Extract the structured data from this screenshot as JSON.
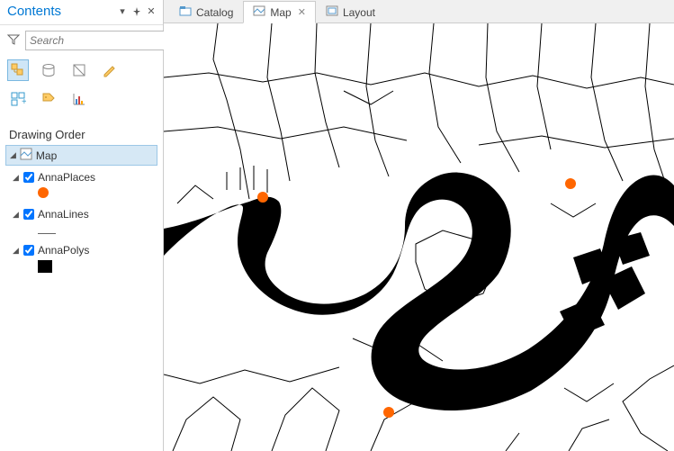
{
  "sidebar": {
    "title": "Contents",
    "search_placeholder": "Search",
    "section_title": "Drawing Order",
    "map_root_label": "Map",
    "layers": [
      {
        "name": "AnnaPlaces",
        "symbol": "point",
        "checked": true
      },
      {
        "name": "AnnaLines",
        "symbol": "line",
        "checked": true
      },
      {
        "name": "AnnaPolys",
        "symbol": "poly",
        "checked": true
      }
    ]
  },
  "tabs": {
    "catalog": "Catalog",
    "map": "Map",
    "layout": "Layout",
    "active": "map"
  },
  "colors": {
    "accent": "#0078d4",
    "point": "#ff6600",
    "selection": "#d6e8f5"
  }
}
